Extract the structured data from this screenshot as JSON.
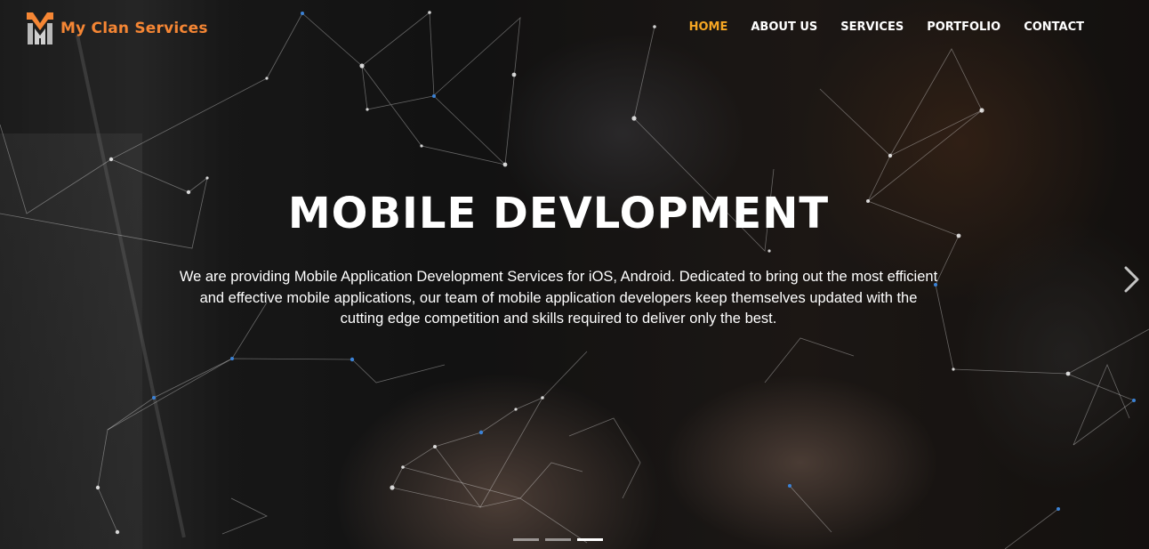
{
  "brand": {
    "name": "My Clan Services",
    "logo_icon": "my-clan-logo-icon",
    "color": "#f58634"
  },
  "nav": {
    "items": [
      {
        "label": "HOME",
        "active": true
      },
      {
        "label": "ABOUT US",
        "active": false
      },
      {
        "label": "SERVICES",
        "active": false
      },
      {
        "label": "PORTFOLIO",
        "active": false
      },
      {
        "label": "CONTACT",
        "active": false
      }
    ],
    "active_color": "#f5a623"
  },
  "hero": {
    "title": "MOBILE DEVLOPMENT",
    "description": "We are providing Mobile Application Development Services for iOS, Android. Dedicated to bring out the most efficient and effective mobile applications, our team of mobile application developers keep themselves updated with the cutting edge competition and skills required to deliver only the best."
  },
  "carousel": {
    "next_icon": "chevron-right-icon",
    "slide_count": 3,
    "active_index": 2
  }
}
